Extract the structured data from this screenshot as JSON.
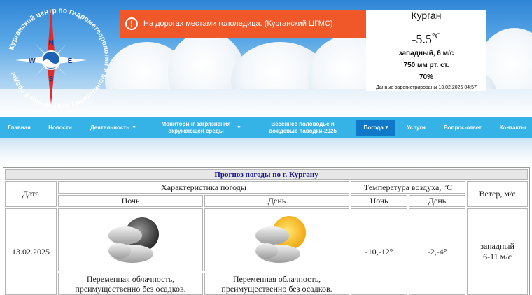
{
  "alert": {
    "icon": "exclamation-icon",
    "text": "На дорогах местами гололедица. (Курганский ЦГМС)",
    "color": "#f0582a"
  },
  "logo": {
    "ring_text": "Курганский центр по гидрометеорологии и мониторингу окружающей среды",
    "directions": {
      "n": "N",
      "e": "E",
      "s": "S",
      "w": "W"
    }
  },
  "current_weather": {
    "city": "Курган",
    "temperature": "-5.5",
    "temperature_unit": "°C",
    "wind": "западный, 6 м/с",
    "pressure": "750 мм рт. ст.",
    "humidity": "70%",
    "registered": "Данные зарегистрированы 13.02.2025 04:57"
  },
  "nav": {
    "color": "#36b3e6",
    "active_color": "#0f78c8",
    "items": [
      {
        "label": "Главная"
      },
      {
        "label": "Новости"
      },
      {
        "label": "Деятельность",
        "caret": "▼"
      },
      {
        "label": "Мониторинг загрязнения окружающей среды",
        "caret": "▼"
      },
      {
        "label": "Весеннее половодье и дождевые паводки-2025"
      },
      {
        "label": "Погода",
        "caret": "▾",
        "active": true
      },
      {
        "label": "Услуги"
      },
      {
        "label": "Вопрос-ответ"
      },
      {
        "label": "Контакты"
      }
    ]
  },
  "forecast": {
    "title": "Прогноз погоды по г. Кургану",
    "col_date": "Дата",
    "col_characteristic": "Характеристика погоды",
    "col_temperature": "Температура воздуха, °С",
    "col_wind": "Ветер, м/с",
    "sub_night": "Ночь",
    "sub_day": "День",
    "sub_temp_night": "Ночь",
    "sub_temp_day": "День",
    "rows": [
      {
        "date": "13.02.2025",
        "night_icon": "cloudy-moon-icon",
        "day_icon": "cloudy-sun-icon",
        "night_desc": "Переменная облачность, преимущественно без осадков.",
        "day_desc": "Переменная облачность, преимущественно без осадков.",
        "temp_night": "-10,-12°",
        "temp_day": "-2,-4°",
        "wind_dir": "западный",
        "wind_speed": "6-11 м/с"
      }
    ]
  }
}
